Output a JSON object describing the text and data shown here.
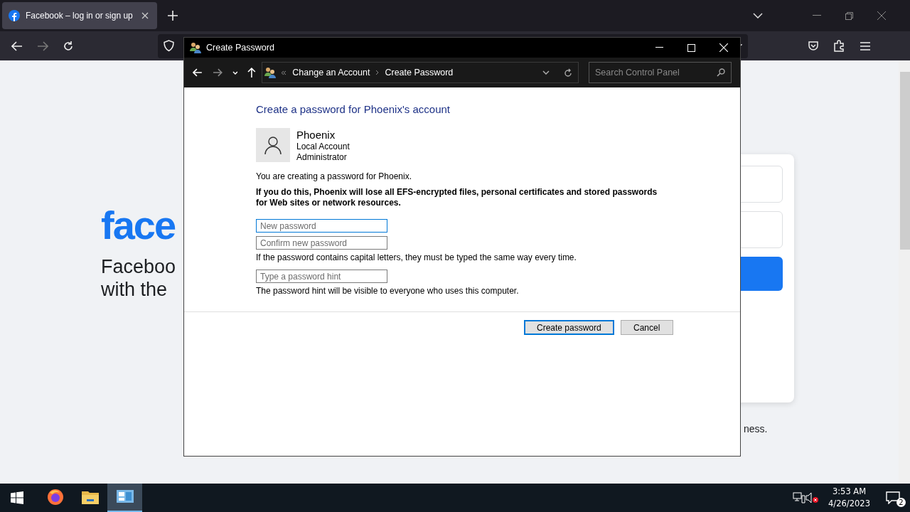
{
  "browser": {
    "tabs": [
      {
        "title": "Facebook – log in or sign up",
        "selected": true
      }
    ]
  },
  "fb_page": {
    "logo": "face",
    "tagline": [
      "Faceboo",
      "with the"
    ],
    "footer_fragment": "ness."
  },
  "dialog": {
    "title": "Create Password",
    "breadcrumb": [
      "Change an Account",
      "Create Password"
    ],
    "search": {
      "placeholder": "Search Control Panel"
    },
    "heading": "Create a password for Phoenix's account",
    "user": {
      "name": "Phoenix",
      "lines": [
        "Local Account",
        "Administrator"
      ]
    },
    "info": "You are creating a password for Phoenix.",
    "warning": "If you do this, Phoenix will lose all EFS-encrypted files, personal certificates and stored passwords for Web sites or network resources.",
    "fields": [
      {
        "placeholder": "New password",
        "focused": true
      },
      {
        "placeholder": "Confirm new password",
        "focused": false
      }
    ],
    "capital_note": "If the password contains capital letters, they must be typed the same way every time.",
    "hint_field": {
      "placeholder": "Type a password hint"
    },
    "hint_note": "The password hint will be visible to everyone who uses this computer.",
    "buttons": [
      {
        "label": "Create password",
        "default": true
      },
      {
        "label": "Cancel",
        "default": false
      }
    ]
  },
  "taskbar": {
    "apps": [
      {
        "kind": "firefox",
        "active": false
      },
      {
        "kind": "folder",
        "active": false
      },
      {
        "kind": "control",
        "active": true
      }
    ],
    "time": "3:53 AM",
    "date": "4/26/2023",
    "notifications": "2"
  }
}
